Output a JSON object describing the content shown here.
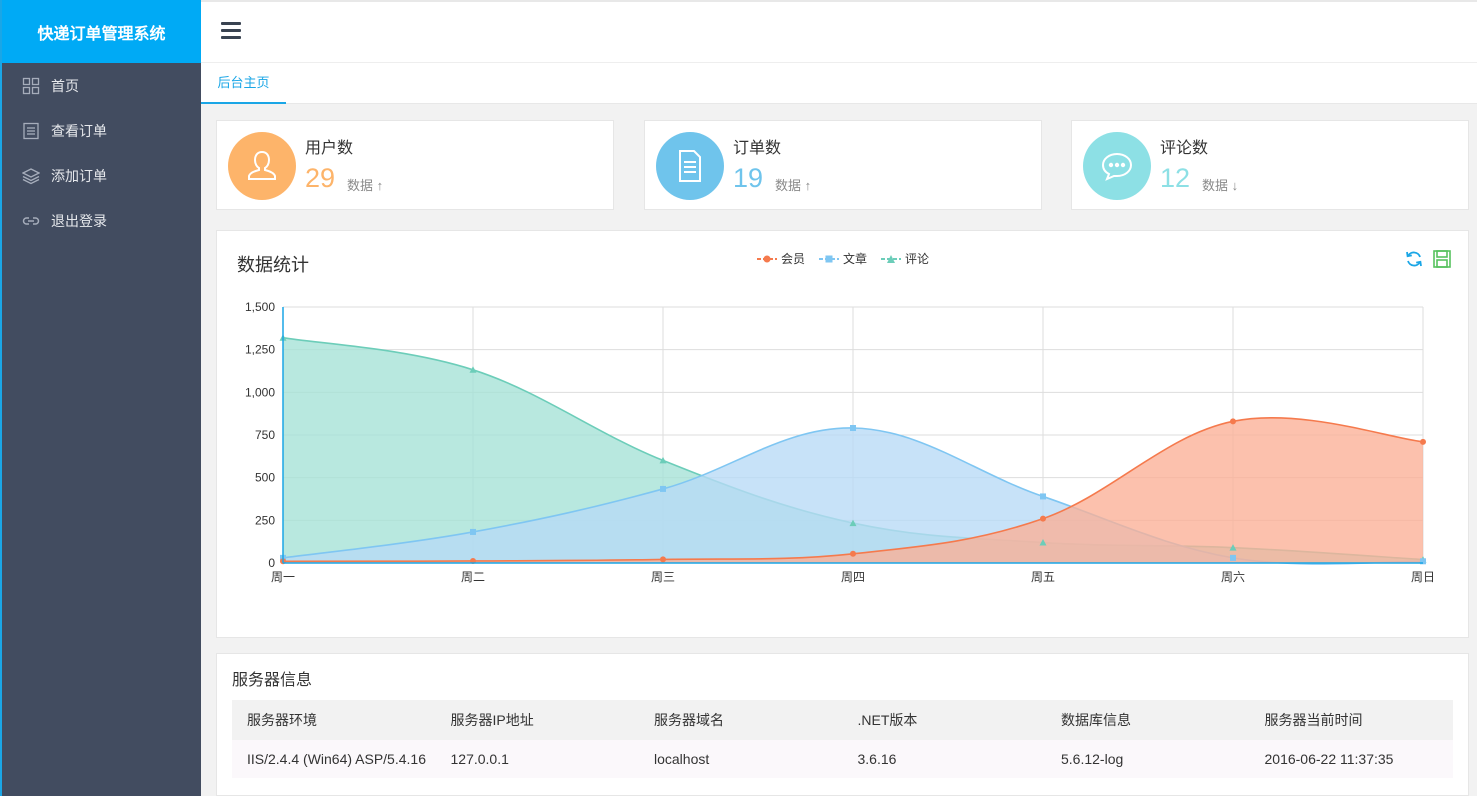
{
  "app": {
    "title": "快递订单管理系统"
  },
  "sidebar": {
    "items": [
      {
        "label": "首页",
        "icon": "grid-icon"
      },
      {
        "label": "查看订单",
        "icon": "list-icon"
      },
      {
        "label": "添加订单",
        "icon": "layers-icon"
      },
      {
        "label": "退出登录",
        "icon": "link-icon"
      }
    ]
  },
  "tabs": [
    {
      "label": "后台主页"
    }
  ],
  "stats": [
    {
      "title": "用户数",
      "value": "29",
      "sub": "数据",
      "trend": "up",
      "color": "#fdb46a",
      "valueColor": "#fdb46a",
      "icon": "user-icon"
    },
    {
      "title": "订单数",
      "value": "19",
      "sub": "数据",
      "trend": "up",
      "color": "#6fc4ec",
      "valueColor": "#6fc4ec",
      "icon": "document-icon"
    },
    {
      "title": "评论数",
      "value": "12",
      "sub": "数据",
      "trend": "down",
      "color": "#8de0e5",
      "valueColor": "#8de0e5",
      "icon": "comment-icon"
    }
  ],
  "chart": {
    "title": "数据统计",
    "tools": [
      "refresh-icon",
      "save-icon"
    ]
  },
  "chart_data": {
    "type": "area",
    "categories": [
      "周一",
      "周二",
      "周三",
      "周四",
      "周五",
      "周六",
      "周日"
    ],
    "ylim": [
      0,
      1500
    ],
    "yticks": [
      "0",
      "250",
      "500",
      "750",
      "1,000",
      "1,250",
      "1,500"
    ],
    "ytick_values": [
      0,
      250,
      500,
      750,
      1000,
      1250,
      1500
    ],
    "grid": true,
    "legend": "top-center",
    "series": [
      {
        "name": "会员",
        "values": [
          10,
          12,
          21,
          54,
          260,
          830,
          710
        ],
        "color": "#f57a4d",
        "fill": "#fbb096"
      },
      {
        "name": "文章",
        "values": [
          30,
          182,
          434,
          791,
          390,
          30,
          10
        ],
        "color": "#7fc6f2",
        "fill": "#b7daf6"
      },
      {
        "name": "评论",
        "values": [
          1320,
          1132,
          601,
          234,
          120,
          90,
          20
        ],
        "color": "#6ccdb9",
        "fill": "#a4e2d6"
      }
    ]
  },
  "server": {
    "title": "服务器信息",
    "headers": [
      "服务器环境",
      "服务器IP地址",
      "服务器域名",
      ".NET版本",
      "数据库信息",
      "服务器当前时间"
    ],
    "row": [
      "IIS/2.4.4 (Win64) ASP/5.4.16",
      "127.0.0.1",
      "localhost",
      "3.6.16",
      "5.6.12-log",
      "2016-06-22 11:37:35"
    ]
  }
}
